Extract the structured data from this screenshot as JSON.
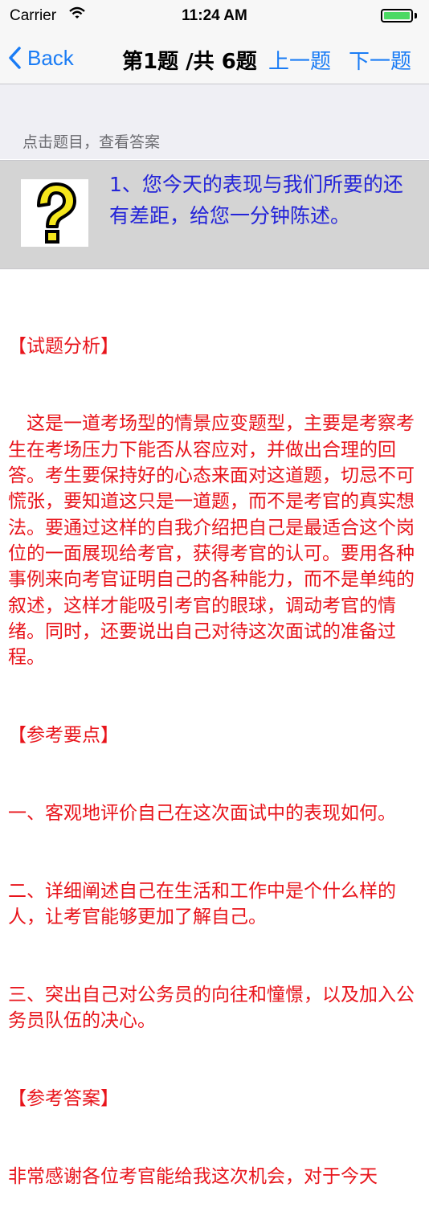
{
  "status_bar": {
    "carrier": "Carrier",
    "time": "11:24 AM"
  },
  "nav": {
    "back_label": "Back",
    "title": "第1题 /共 6题",
    "prev_label": "上一题",
    "next_label": "下一题"
  },
  "hint": "点击题目，查看答案",
  "question": {
    "icon": "question-mark-icon",
    "text": "1、您今天的表现与我们所要的还有差距，给您一分钟陈述。"
  },
  "answer": {
    "lines": [
      "【试题分析】",
      "　这是一道考场型的情景应变题型，主要是考察考生在考场压力下能否从容应对，并做出合理的回答。考生要保持好的心态来面对这道题，切忌不可慌张，要知道这只是一道题，而不是考官的真实想法。要通过这样的自我介绍把自己是最适合这个岗位的一面展现给考官，获得考官的认可。要用各种事例来向考官证明自己的各种能力，而不是单纯的叙述，这样才能吸引考官的眼球，调动考官的情绪。同时，还要说出自己对待这次面试的准备过程。",
      "【参考要点】",
      "一、客观地评价自己在这次面试中的表现如何。",
      "二、详细阐述自己在生活和工作中是个什么样的人，让考官能够更加了解自己。",
      "三、突出自己对公务员的向往和憧憬，以及加入公务员队伍的决心。",
      "【参考答案】",
      "非常感谢各位考官能给我这次机会，对于今天"
    ]
  },
  "colors": {
    "accent": "#1a7cf5",
    "question_text": "#2424d8",
    "answer_text": "#e8141b",
    "battery": "#4cd964"
  }
}
